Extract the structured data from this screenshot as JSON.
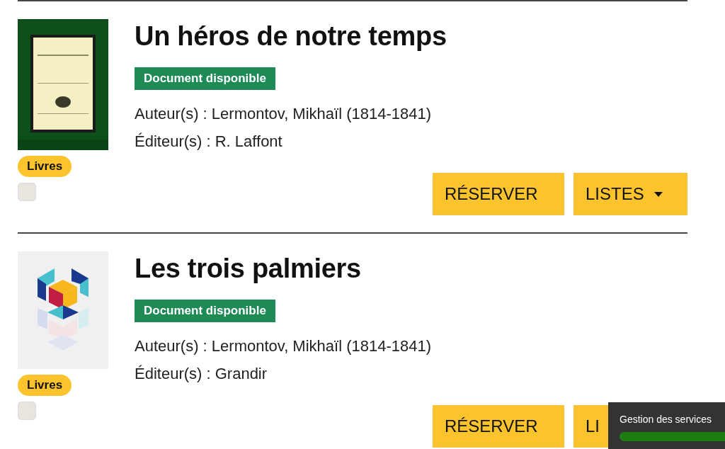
{
  "records": [
    {
      "title": "Un héros de notre temps",
      "availability": "Document disponible",
      "details": [
        {
          "label": "Auteur(s) :",
          "value": "Lermontov, Mikhaïl (1814-1841)"
        },
        {
          "label": "Éditeur(s) :",
          "value": "R. Laffont"
        }
      ],
      "type": "Livres",
      "checked": false,
      "buttons": [
        {
          "label": "RÉSERVER",
          "kind": "action"
        },
        {
          "label": "LISTES",
          "kind": "dropdown"
        }
      ]
    },
    {
      "title": "Les trois palmiers",
      "cover": {
        "kind": "placeholder"
      },
      "availability": "Document disponible",
      "details": [
        {
          "label": "Auteur(s) :",
          "value": "Lermontov, Mikhaïl (1814-1841)"
        },
        {
          "label": "Éditeur(s) :",
          "value": "Grandir"
        }
      ],
      "type": "Livres",
      "checked": false,
      "buttons": [
        {
          "label": "RÉSERVER",
          "kind": "action"
        },
        {
          "label": "LI",
          "kind": "covered"
        }
      ]
    }
  ],
  "toast": {
    "message": "Gestion des services",
    "level": 1
  }
}
